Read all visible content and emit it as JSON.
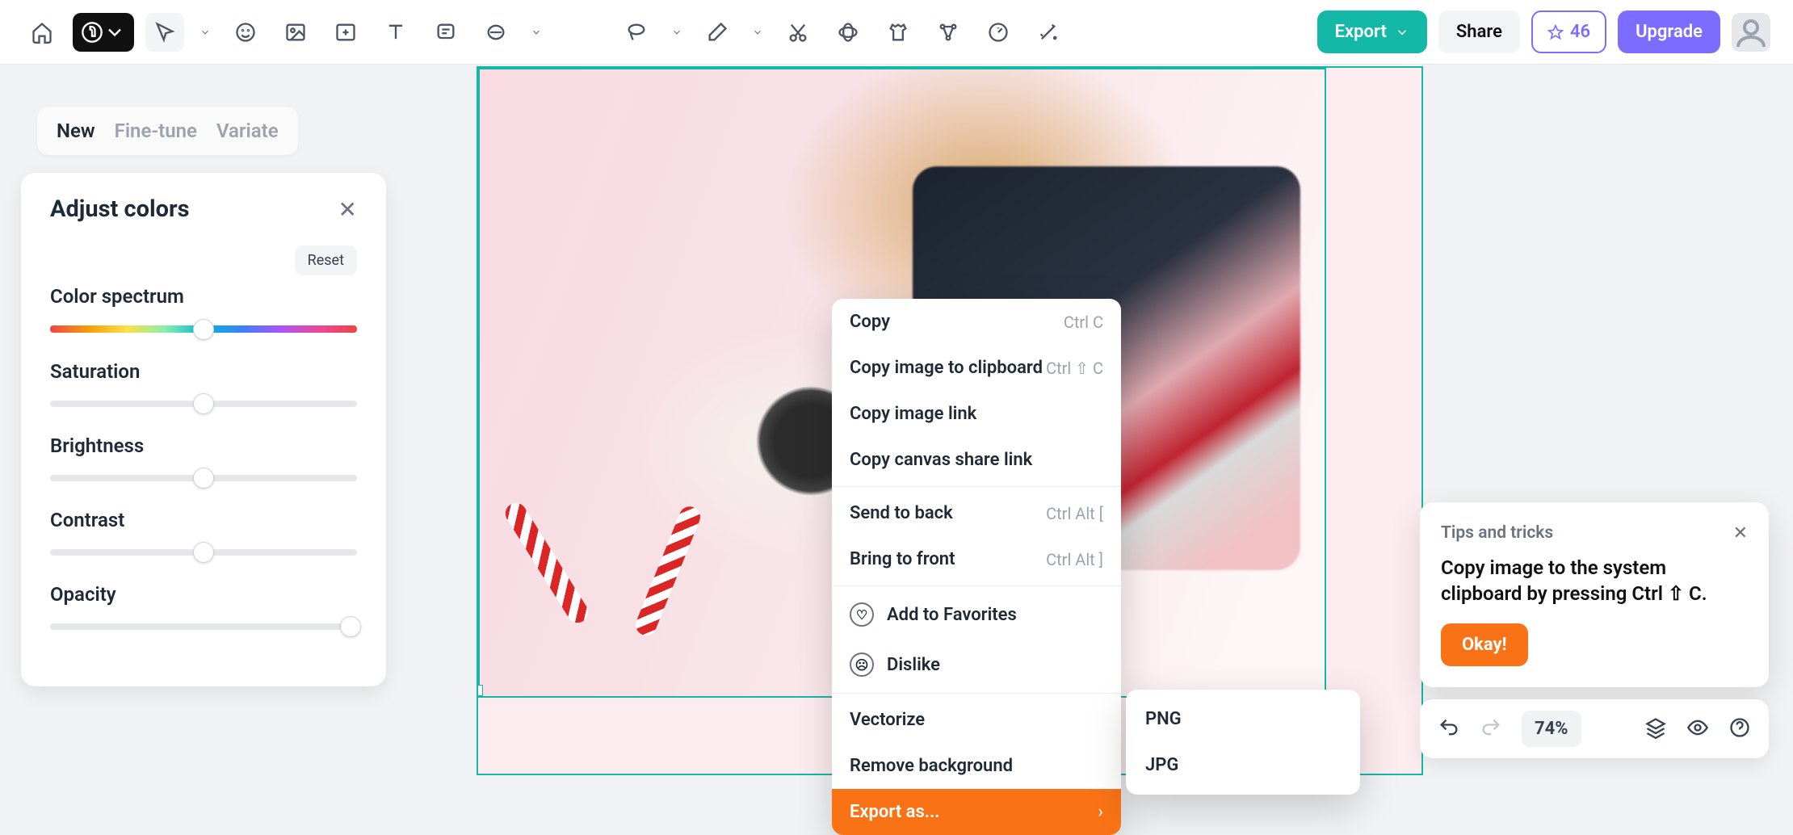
{
  "toolbar": {
    "export": "Export",
    "share": "Share",
    "credits": "46",
    "upgrade": "Upgrade"
  },
  "tabs": {
    "new": "New",
    "fine": "Fine-tune",
    "variate": "Variate"
  },
  "panel": {
    "title": "Adjust colors",
    "reset": "Reset",
    "sliders": {
      "spectrum": "Color spectrum",
      "saturation": "Saturation",
      "brightness": "Brightness",
      "contrast": "Contrast",
      "opacity": "Opacity"
    }
  },
  "ctx": {
    "copy": "Copy",
    "copy_sc": "Ctrl C",
    "copyclip": "Copy image to clipboard",
    "copyclip_sc": "Ctrl ⇧ C",
    "copylink": "Copy image link",
    "copycanvas": "Copy canvas share link",
    "sendback": "Send to back",
    "sendback_sc": "Ctrl Alt [",
    "bringfront": "Bring to front",
    "bringfront_sc": "Ctrl Alt ]",
    "fav": "Add to Favorites",
    "dislike": "Dislike",
    "vectorize": "Vectorize",
    "removebg": "Remove background",
    "exportas": "Export as..."
  },
  "submenu": {
    "png": "PNG",
    "jpg": "JPG"
  },
  "tips": {
    "title": "Tips and tricks",
    "body": "Copy image to the system clipboard by pressing Ctrl ⇧ C.",
    "okay": "Okay!"
  },
  "bottom": {
    "zoom": "74%"
  }
}
